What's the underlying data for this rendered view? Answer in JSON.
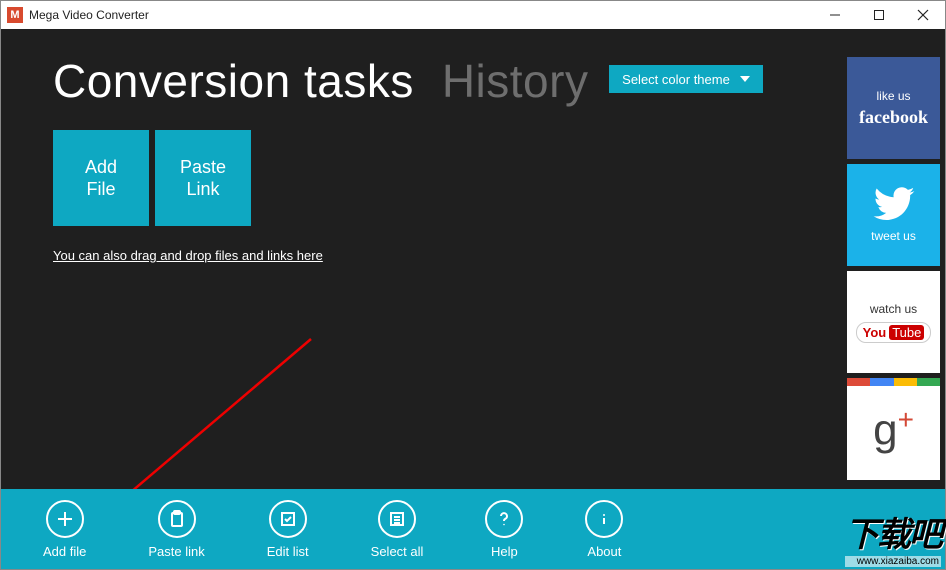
{
  "window": {
    "title": "Mega Video Converter",
    "icon_letter": "M"
  },
  "theme_button": "Select color theme",
  "tabs": {
    "conversion": "Conversion tasks",
    "history": "History"
  },
  "tiles": {
    "add_file_l1": "Add",
    "add_file_l2": "File",
    "paste_link_l1": "Paste",
    "paste_link_l2": "Link"
  },
  "hint": "You can also drag and drop files and links here",
  "social": {
    "fb_caption": "like us",
    "fb_brand": "facebook",
    "tw_caption": "tweet us",
    "yt_caption": "watch us",
    "yt_brand_a": "You",
    "yt_brand_b": "Tube",
    "gp_symbol": "g",
    "gp_plus": "+"
  },
  "bottombar": {
    "add_file": "Add file",
    "paste_link": "Paste link",
    "edit_list": "Edit list",
    "select_all": "Select all",
    "help": "Help",
    "about": "About"
  },
  "watermark": {
    "big": "下载吧",
    "url": "www.xiazaiba.com"
  }
}
